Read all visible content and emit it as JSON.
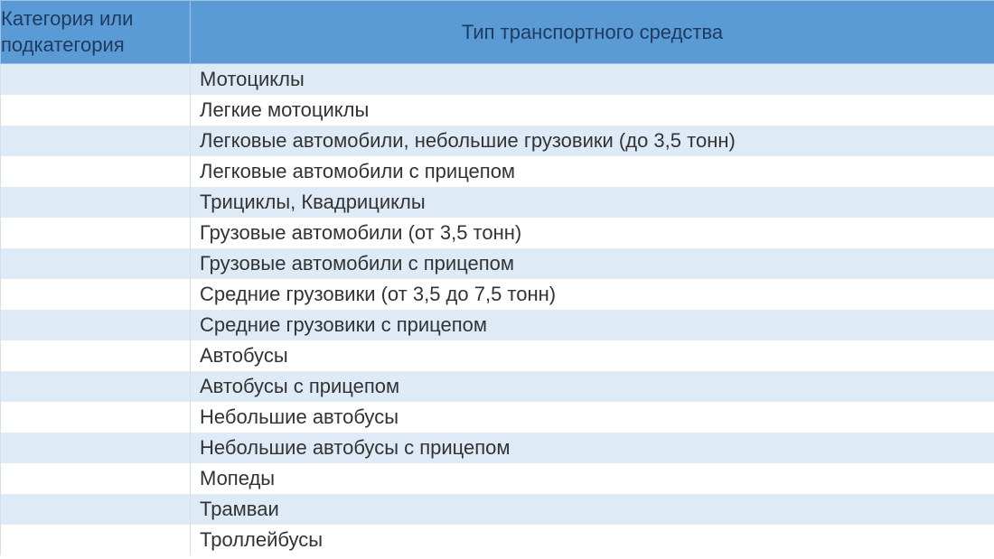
{
  "headers": {
    "category": "Категория или подкатегория",
    "type": "Тип транспортного средства"
  },
  "rows": [
    {
      "category": "",
      "type": "Мотоциклы"
    },
    {
      "category": "",
      "type": "Легкие мотоциклы"
    },
    {
      "category": "",
      "type": "Легковые автомобили, небольшие грузовики (до 3,5 тонн)"
    },
    {
      "category": "",
      "type": "Легковые автомобили с прицепом"
    },
    {
      "category": "",
      "type": "Трициклы, Квадрициклы"
    },
    {
      "category": "",
      "type": "Грузовые автомобили (от 3,5 тонн)"
    },
    {
      "category": "",
      "type": "Грузовые автомобили с прицепом"
    },
    {
      "category": "",
      "type": "Средние грузовики (от 3,5 до 7,5 тонн)"
    },
    {
      "category": "",
      "type": "Средние грузовики с прицепом"
    },
    {
      "category": "",
      "type": "Автобусы"
    },
    {
      "category": "",
      "type": "Автобусы с прицепом"
    },
    {
      "category": "",
      "type": "Небольшие автобусы"
    },
    {
      "category": "",
      "type": "Небольшие автобусы с прицепом"
    },
    {
      "category": "",
      "type": "Мопеды"
    },
    {
      "category": "",
      "type": "Трамваи"
    },
    {
      "category": "",
      "type": "Троллейбусы"
    }
  ]
}
